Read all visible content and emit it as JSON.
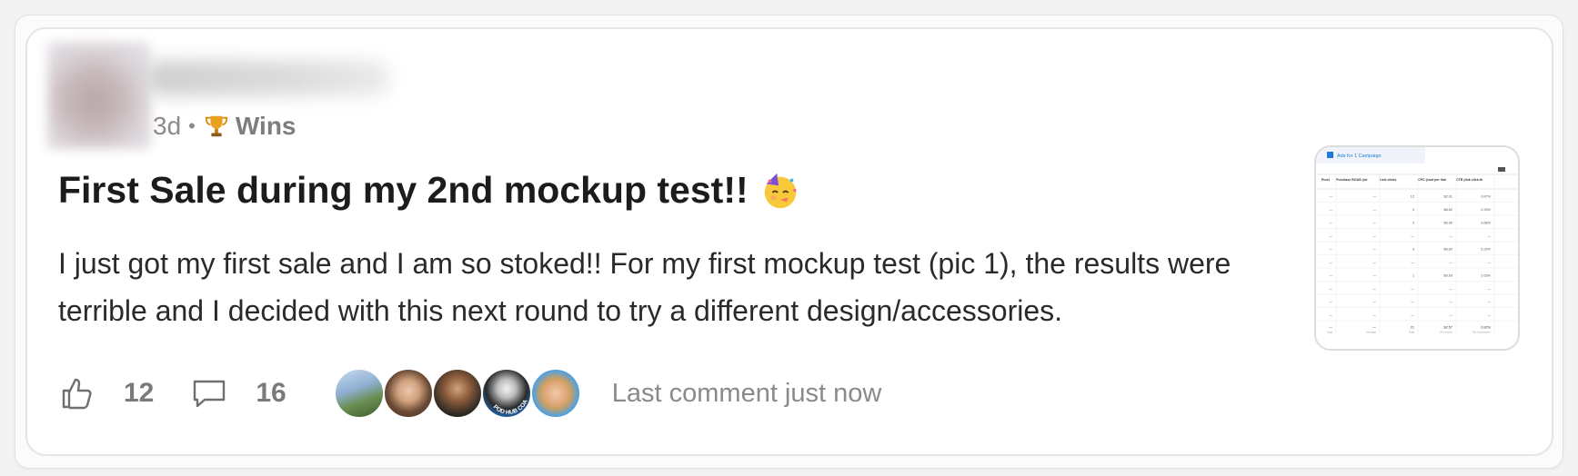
{
  "post": {
    "time_ago": "3d",
    "separator": "•",
    "category": "Wins",
    "category_icon": "trophy-icon",
    "title": "First Sale during my 2nd mockup test!!",
    "title_emoji": "partying-face-icon",
    "body": "I just got my first sale and I am so stoked!! For my first mockup test (pic 1), the results were terrible and I decided with this next round to try a different design/accessories."
  },
  "thumbnail": {
    "header": "Ads for 1 Campaign",
    "columns": [
      "Purcl",
      "Purchase ROAS (return...",
      "Link clicks",
      "CPC (cost per link click)",
      "CTR (link click-through rate)"
    ],
    "rows": [
      [
        "—",
        "—",
        "12",
        "$2.91",
        "0.87%"
      ],
      [
        "—",
        "—",
        "2",
        "$8.52",
        "0.39%"
      ],
      [
        "—",
        "—",
        "3",
        "$5.06",
        "0.68%"
      ],
      [
        "—",
        "—",
        "—",
        "—",
        "—"
      ],
      [
        "—",
        "—",
        "3",
        "$6.82",
        "5.26%"
      ],
      [
        "—",
        "—",
        "—",
        "—",
        "—"
      ],
      [
        "—",
        "—",
        "1",
        "$0.69",
        "2.63%"
      ],
      [
        "—",
        "—",
        "—",
        "—",
        "—"
      ],
      [
        "—",
        "—",
        "—",
        "—",
        "—"
      ],
      [
        "—",
        "—",
        "—",
        "—",
        "—"
      ]
    ],
    "totals": [
      "—",
      "—",
      "21",
      "$2.57",
      "0.82%"
    ],
    "totals_sub": [
      "Total",
      "Average",
      "Total",
      "Per Action",
      "Per Impression"
    ]
  },
  "footer": {
    "likes": "12",
    "comments": "16",
    "last_comment": "Last comment just now",
    "commenter_badge": "POD HUB COACH"
  },
  "colors": {
    "accent_blue": "#1f7ad6",
    "muted_text": "#8a8a8a"
  }
}
